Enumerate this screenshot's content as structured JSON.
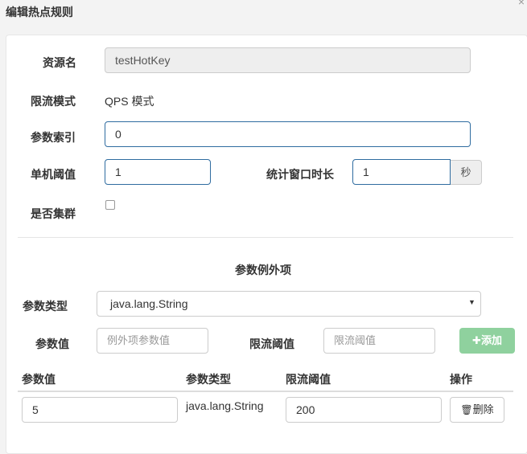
{
  "dialog": {
    "title": "编辑热点规则",
    "close_glyph": "×"
  },
  "form": {
    "resource_label": "资源名",
    "resource_value": "testHotKey",
    "mode_label": "限流模式",
    "mode_value": "QPS 模式",
    "param_index_label": "参数索引",
    "param_index_value": "0",
    "threshold_label": "单机阈值",
    "threshold_value": "1",
    "window_label": "统计窗口时长",
    "window_value": "1",
    "window_unit": "秒",
    "cluster_label": "是否集群",
    "cluster_checked": false
  },
  "exceptions": {
    "section_title": "参数例外项",
    "param_type_label": "参数类型",
    "param_type_selected": "java.lang.String",
    "param_value_label": "参数值",
    "param_value_placeholder": "例外项参数值",
    "limit_label": "限流阈值",
    "limit_placeholder": "限流阈值",
    "add_button": "添加",
    "add_icon": "plus-icon",
    "table": {
      "headers": [
        "参数值",
        "参数类型",
        "限流阈值",
        "操作"
      ],
      "rows": [
        {
          "value": "5",
          "type": "java.lang.String",
          "limit": "200",
          "action": "删除",
          "action_icon": "trash-icon"
        }
      ]
    }
  },
  "colors": {
    "input_border": "#2f6ca0",
    "add_button": "#8fd19e",
    "disabled_bg": "#eeeeee"
  }
}
